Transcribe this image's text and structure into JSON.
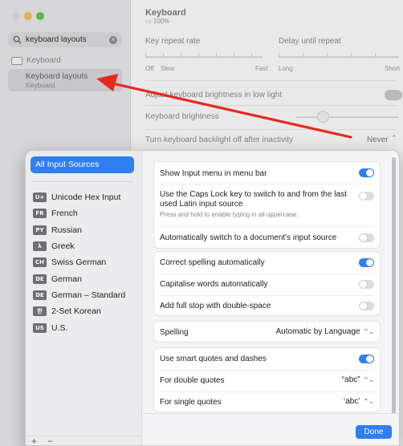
{
  "background": {
    "search": {
      "value": "keyboard layouts"
    },
    "sidebar": {
      "keyboard_item": "Keyboard",
      "result_title": "Keyboard layouts",
      "result_subtitle": "Keyboard"
    },
    "main": {
      "title": "Keyboard",
      "battery": "100%",
      "key_repeat_label": "Key repeat rate",
      "delay_label": "Delay until repeat",
      "repeat_min": "Off",
      "repeat_slow": "Slow",
      "repeat_fast": "Fast",
      "delay_long": "Long",
      "delay_short": "Short",
      "adjust_brightness": "Adjust keyboard brightness in low light",
      "brightness_label": "Keyboard brightness",
      "backlight_label": "Turn keyboard backlight off after inactivity",
      "backlight_value": "Never"
    }
  },
  "sheet": {
    "sidebar": {
      "all_sources": "All Input Sources",
      "sources": [
        {
          "badge": "U+",
          "label": "Unicode Hex Input"
        },
        {
          "badge": "FR",
          "label": "French"
        },
        {
          "badge": "PY",
          "label": "Russian"
        },
        {
          "badge": "λ",
          "label": "Greek"
        },
        {
          "badge": "CH",
          "label": "Swiss German"
        },
        {
          "badge": "DE",
          "label": "German"
        },
        {
          "badge": "DE",
          "label": "German – Standard"
        },
        {
          "badge": "한",
          "label": "2-Set Korean"
        },
        {
          "badge": "US",
          "label": "U.S."
        }
      ],
      "add": "+",
      "remove": "−"
    },
    "settings": {
      "show_input_menu": {
        "label": "Show Input menu in menu bar",
        "on": true
      },
      "caps_lock": {
        "label": "Use the Caps Lock key to switch to and from the last used Latin input source",
        "hint": "Press and hold to enable typing in all uppercase.",
        "on": false
      },
      "auto_switch": {
        "label": "Automatically switch to a document's input source",
        "on": false
      },
      "correct_spelling": {
        "label": "Correct spelling automatically",
        "on": true
      },
      "capitalise": {
        "label": "Capitalise words automatically",
        "on": false
      },
      "full_stop": {
        "label": "Add full stop with double-space",
        "on": false
      },
      "spelling": {
        "label": "Spelling",
        "value": "Automatic by Language"
      },
      "smart_quotes": {
        "label": "Use smart quotes and dashes",
        "on": true
      },
      "double_quotes": {
        "label": "For double quotes",
        "value": "“abc”"
      },
      "single_quotes": {
        "label": "For single quotes",
        "value": "‘abc’"
      }
    },
    "done": "Done"
  },
  "colors": {
    "accent": "#2f7ff0",
    "arrow": "#e8281e"
  }
}
